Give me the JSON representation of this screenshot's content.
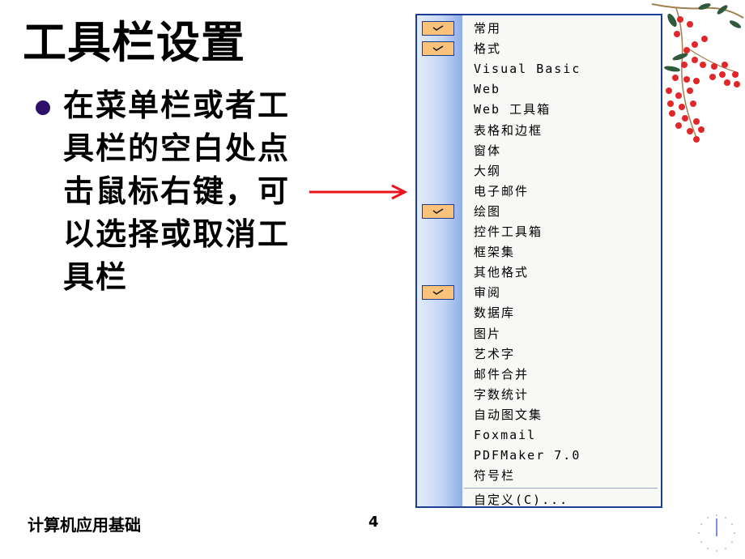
{
  "slide": {
    "title": "工具栏设置",
    "bullet": "在菜单栏或者工具栏的空白处点击鼠标右键，可以选择或取消工具栏",
    "footer_left": "计算机应用基础",
    "page_number": "4"
  },
  "context_menu": {
    "items": [
      {
        "label": "常用",
        "checked": true
      },
      {
        "label": "格式",
        "checked": true
      },
      {
        "label": "Visual Basic",
        "checked": false
      },
      {
        "label": "Web",
        "checked": false
      },
      {
        "label": "Web 工具箱",
        "checked": false
      },
      {
        "label": "表格和边框",
        "checked": false
      },
      {
        "label": "窗体",
        "checked": false
      },
      {
        "label": "大纲",
        "checked": false
      },
      {
        "label": "电子邮件",
        "checked": false
      },
      {
        "label": "绘图",
        "checked": true
      },
      {
        "label": "控件工具箱",
        "checked": false
      },
      {
        "label": "框架集",
        "checked": false
      },
      {
        "label": "其他格式",
        "checked": false
      },
      {
        "label": "审阅",
        "checked": true
      },
      {
        "label": "数据库",
        "checked": false
      },
      {
        "label": "图片",
        "checked": false
      },
      {
        "label": "艺术字",
        "checked": false
      },
      {
        "label": "邮件合并",
        "checked": false
      },
      {
        "label": "字数统计",
        "checked": false
      },
      {
        "label": "自动图文集",
        "checked": false
      },
      {
        "label": "Foxmail",
        "checked": false
      },
      {
        "label": "PDFMaker 7.0",
        "checked": false
      },
      {
        "label": "符号栏",
        "checked": false
      }
    ],
    "customize_label": "自定义(C)..."
  },
  "colors": {
    "menu_border": "#1c3f94",
    "check_fill": "#fbc27b",
    "arrow": "#e8141a",
    "bullet": "#2e0f6b"
  }
}
